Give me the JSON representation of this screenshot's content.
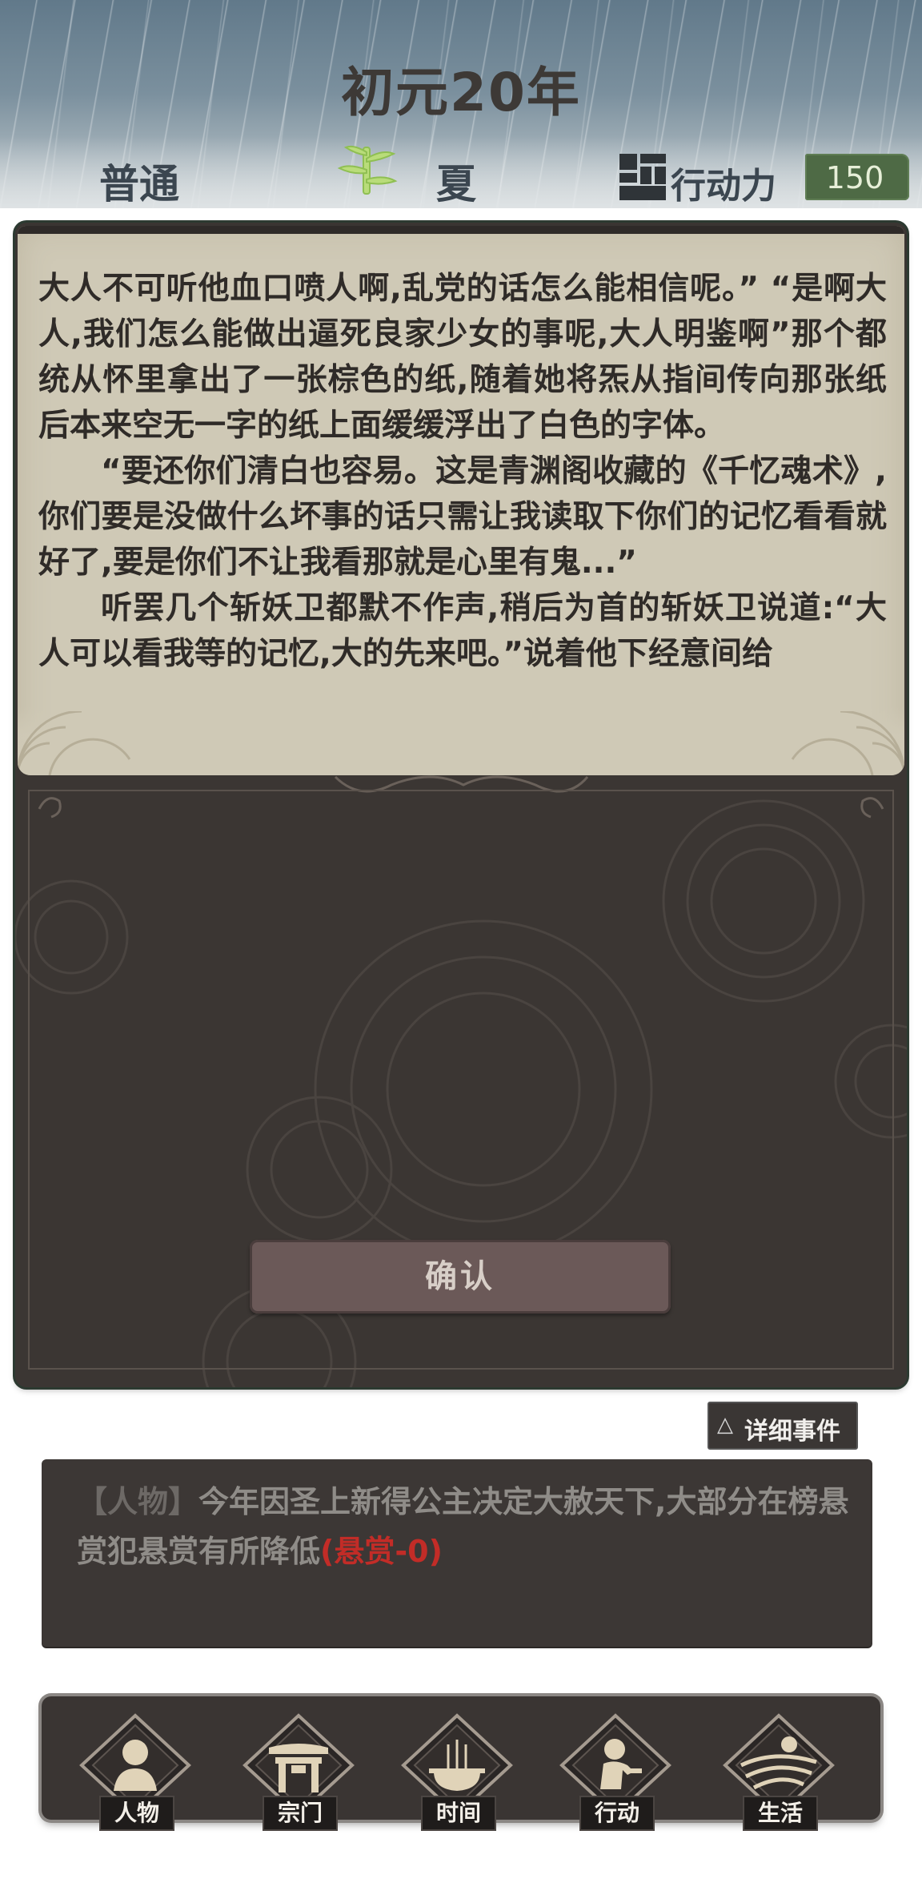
{
  "header": {
    "year_title": "初元20年",
    "difficulty": "普通",
    "season": "夏",
    "action_points_label": "行动力",
    "action_points_value": "150",
    "icons": [
      "bamboo-season-icon",
      "action-points-icon"
    ]
  },
  "story": {
    "paragraphs": [
      "大人不可听他血口喷人啊,乱党的话怎么能相信呢。” “是啊大人,我们怎么能做出逼死良家少女的事呢,大人明鉴啊”那个都统从怀里拿出了一张棕色的纸,随着她将炁从指间传向那张纸后本来空无一字的纸上面缓缓浮出了白色的字体。",
      "“要还你们清白也容易。这是青渊阁收藏的《千忆魂术》,你们要是没做什么坏事的话只需让我读取下你们的记忆看看就好了,要是你们不让我看那就是心里有鬼...”",
      "听罢几个斩妖卫都默不作声,稍后为首的斩妖卫说道:“大人可以看我等的记忆,大的先来吧。”说着他下经意间给"
    ],
    "confirm_label": "确认"
  },
  "detail_button": {
    "icon": "triangle-up-icon",
    "label": "详细事件"
  },
  "log": {
    "tag": "【人物】",
    "text": "今年因圣上新得公主决定大赦天下,大部分在榜悬赏犯悬赏有所降低",
    "highlight": "(悬赏-0)",
    "highlight_color": "#c22c27"
  },
  "nav": {
    "items": [
      {
        "label": "人物",
        "icon": "character-icon"
      },
      {
        "label": "宗门",
        "icon": "sect-gate-icon"
      },
      {
        "label": "时间",
        "icon": "incense-time-icon"
      },
      {
        "label": "行动",
        "icon": "action-figure-icon"
      },
      {
        "label": "生活",
        "icon": "life-landscape-icon"
      }
    ]
  },
  "colors": {
    "parchment": "#cfc9b6",
    "dark_panel": "#3b3633",
    "action_badge": "#4e6a45",
    "button": "#6b5958"
  }
}
